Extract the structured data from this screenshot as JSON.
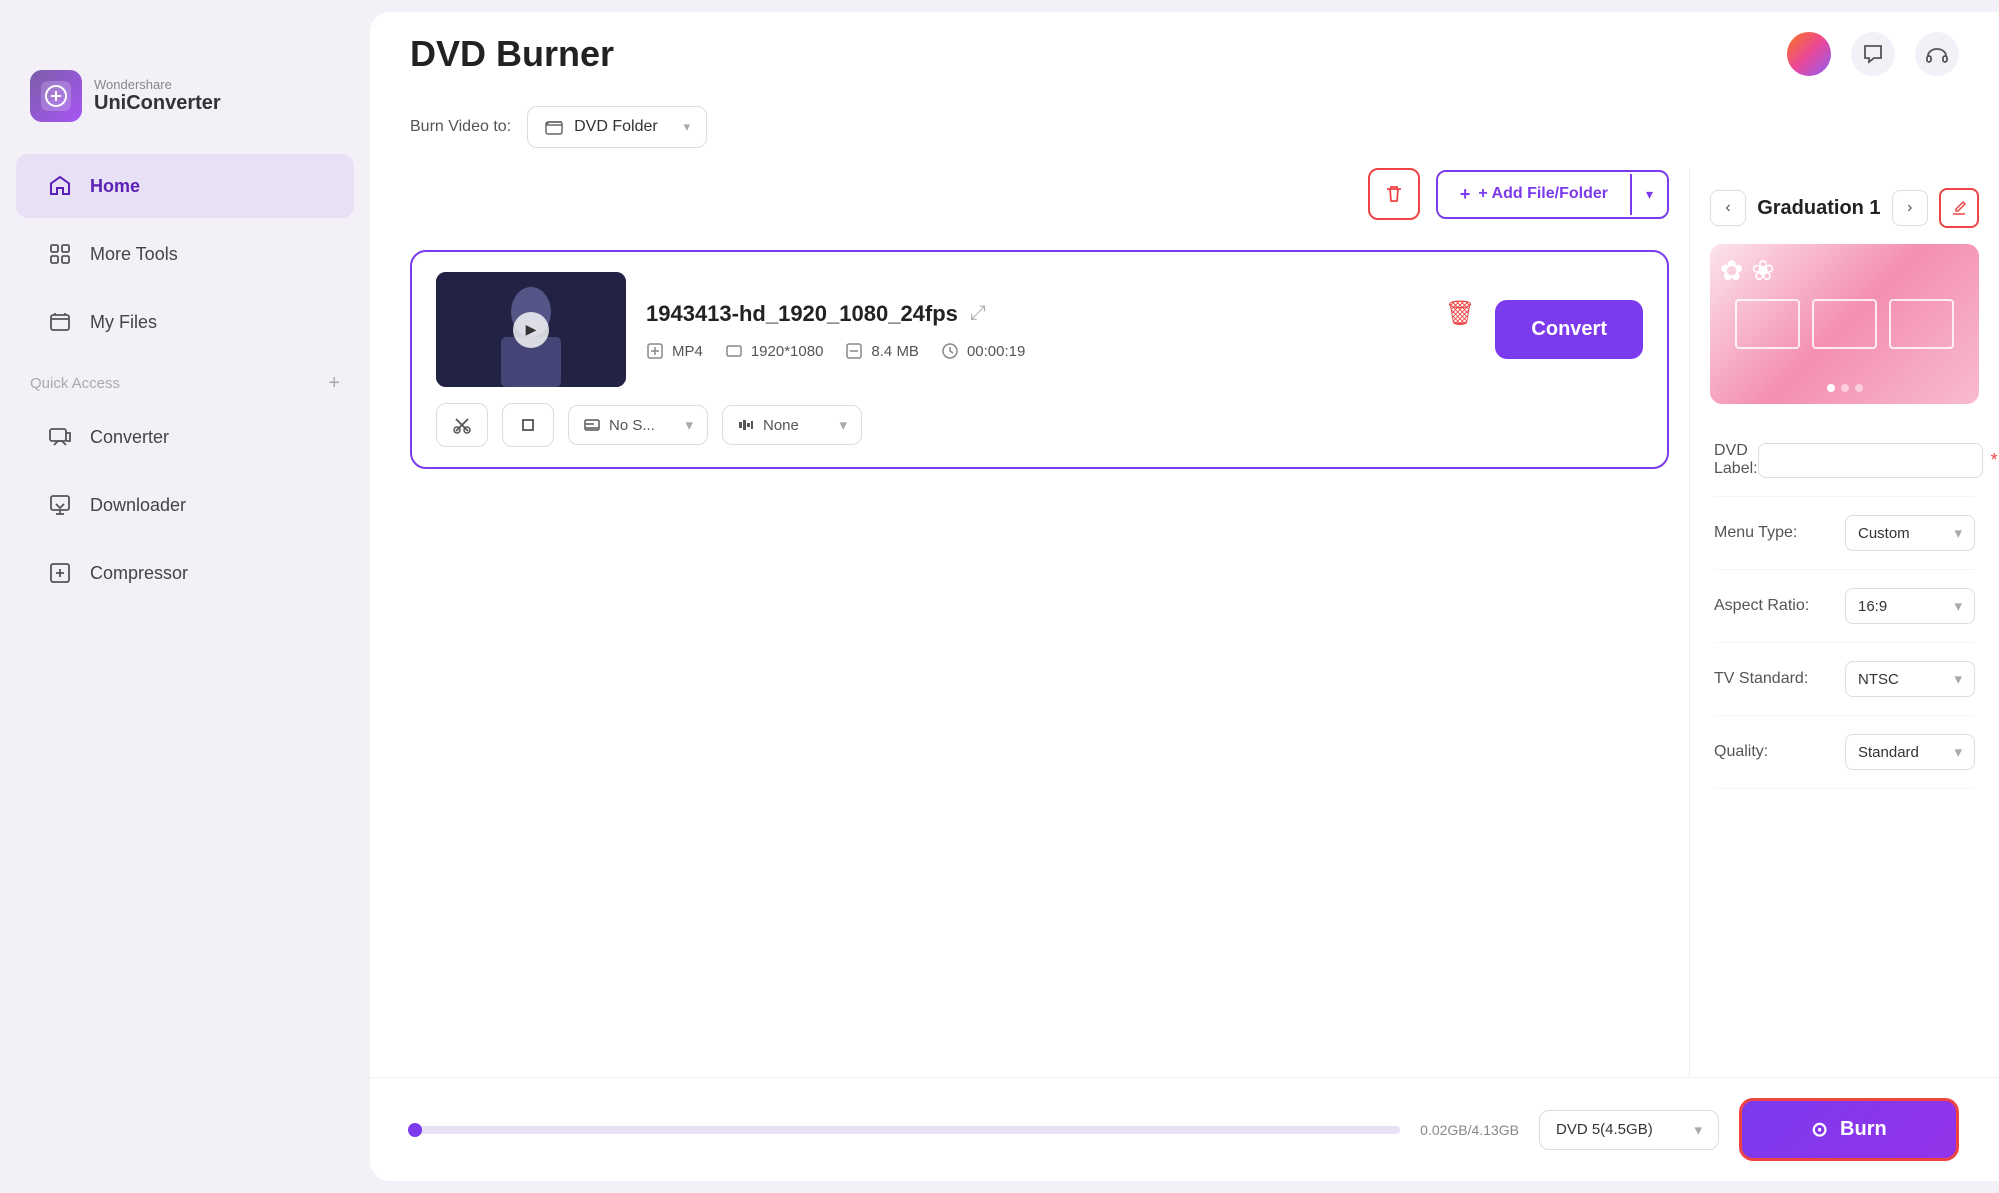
{
  "window": {
    "title": "Wondershare UniConverter"
  },
  "logo": {
    "brand": "Wondershare",
    "name": "UniConverter"
  },
  "nav": {
    "home": "Home",
    "more_tools": "More Tools",
    "my_files": "My Files"
  },
  "quick_access": {
    "label": "Quick Access",
    "plus": "+",
    "items": [
      {
        "id": "converter",
        "label": "Converter"
      },
      {
        "id": "downloader",
        "label": "Downloader"
      },
      {
        "id": "compressor",
        "label": "Compressor"
      }
    ]
  },
  "page": {
    "title": "DVD Burner"
  },
  "burn_video": {
    "label": "Burn Video to:",
    "target": "DVD Folder",
    "chevron": "▾"
  },
  "actions": {
    "delete_label": "🗑",
    "add_file": "+ Add File/Folder",
    "chevron": "▾"
  },
  "video_card": {
    "filename": "1943413-hd_1920_1080_24fps",
    "format": "MP4",
    "resolution": "1920*1080",
    "size": "8.4 MB",
    "duration": "00:00:19",
    "convert_label": "Convert",
    "subtitle_label": "No S...",
    "audio_label": "None"
  },
  "right_panel": {
    "template_title": "Graduation 1",
    "prev_label": "‹",
    "next_label": "›",
    "dvd_label_field": "",
    "dvd_label_placeholder": "",
    "menu_type": "Custom",
    "aspect_ratio": "16:9",
    "tv_standard": "NTSC",
    "quality": "Standard",
    "labels": {
      "dvd_label": "DVD Label:",
      "menu_type": "Menu Type:",
      "aspect_ratio": "Aspect Ratio:",
      "tv_standard": "TV Standard:",
      "quality": "Quality:"
    }
  },
  "bottom": {
    "progress_text": "0.02GB/4.13GB",
    "dvd_size": "DVD 5(4.5GB)",
    "burn_label": "Burn",
    "burn_icon": "⊙"
  }
}
